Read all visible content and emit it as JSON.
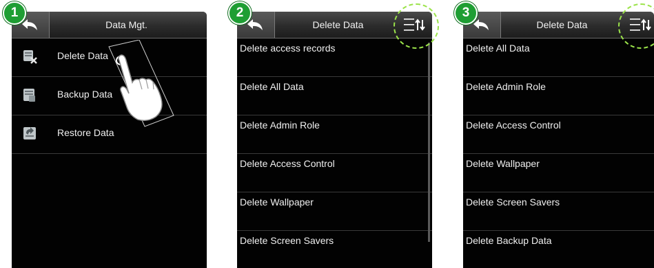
{
  "steps": [
    "1",
    "2",
    "3"
  ],
  "screen1": {
    "title": "Data Mgt.",
    "items": [
      {
        "label": "Delete Data",
        "icon": "delete-data-icon"
      },
      {
        "label": "Backup Data",
        "icon": "backup-data-icon"
      },
      {
        "label": "Restore Data",
        "icon": "restore-data-icon"
      }
    ]
  },
  "screen2": {
    "title": "Delete Data",
    "items": [
      "Delete access records",
      "Delete All Data",
      "Delete Admin Role",
      "Delete Access Control",
      "Delete Wallpaper",
      "Delete Screen Savers"
    ]
  },
  "screen3": {
    "title": "Delete Data",
    "items": [
      "Delete All Data",
      "Delete Admin Role",
      "Delete Access Control",
      "Delete Wallpaper",
      "Delete Screen Savers",
      "Delete Backup Data"
    ]
  },
  "colors": {
    "badge": "#1e9e33",
    "highlight": "#9be34a",
    "screen_bg": "#020202"
  }
}
